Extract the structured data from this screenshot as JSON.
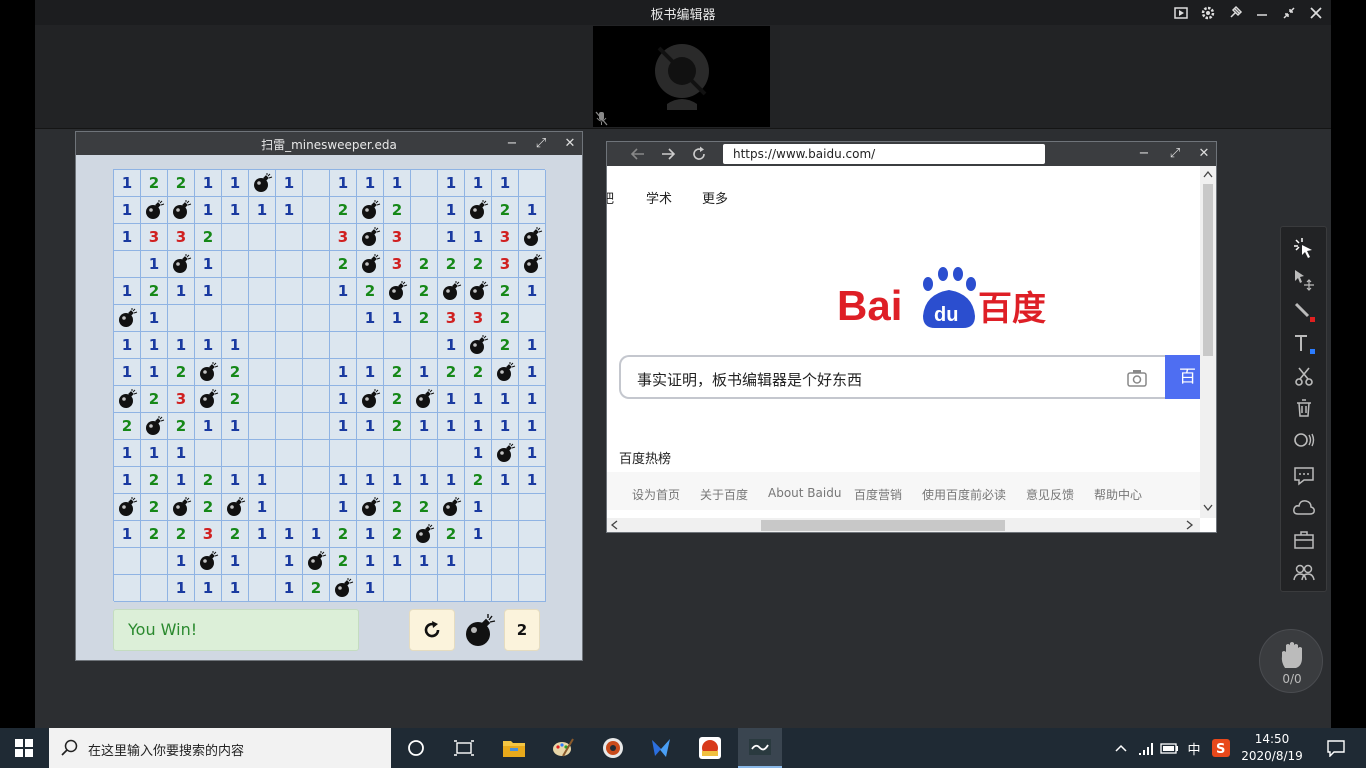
{
  "app": {
    "title": "板书编辑器"
  },
  "minesweeper": {
    "title": "扫雷_minesweeper.eda",
    "grid": [
      [
        "1",
        "2",
        "2",
        "1",
        "1",
        "*",
        "1",
        "",
        "1",
        "1",
        "1",
        "",
        "1",
        "1",
        "1",
        ""
      ],
      [
        "1",
        "*",
        "*",
        "1",
        "1",
        "1",
        "1",
        "",
        "2",
        "*",
        "2",
        "",
        "1",
        "*",
        "2",
        "1"
      ],
      [
        "1",
        "3",
        "3",
        "2",
        "",
        "",
        "",
        "",
        "3",
        "*",
        "3",
        "",
        "1",
        "1",
        "3",
        "*"
      ],
      [
        "",
        "1",
        "*",
        "1",
        "",
        "",
        "",
        "",
        "2",
        "*",
        "3",
        "2",
        "2",
        "2",
        "3",
        "*"
      ],
      [
        "1",
        "2",
        "1",
        "1",
        "",
        "",
        "",
        "",
        "1",
        "2",
        "*",
        "2",
        "*",
        "*",
        "2",
        "1"
      ],
      [
        "*",
        "1",
        "",
        "",
        "",
        "",
        "",
        "",
        "",
        "1",
        "1",
        "2",
        "3",
        "3",
        "2",
        ""
      ],
      [
        "1",
        "1",
        "1",
        "1",
        "1",
        "",
        "",
        "",
        "",
        "",
        "",
        "",
        "1",
        "*",
        "2",
        "1"
      ],
      [
        "1",
        "1",
        "2",
        "*",
        "2",
        "",
        "",
        "",
        "1",
        "1",
        "2",
        "1",
        "2",
        "2",
        "*",
        "1"
      ],
      [
        "*",
        "2",
        "3",
        "*",
        "2",
        "",
        "",
        "",
        "1",
        "*",
        "2",
        "*",
        "1",
        "1",
        "1",
        "1"
      ],
      [
        "2",
        "*",
        "2",
        "1",
        "1",
        "",
        "",
        "",
        "1",
        "1",
        "2",
        "1",
        "1",
        "1",
        "1",
        "1"
      ],
      [
        "1",
        "1",
        "1",
        "",
        "",
        "",
        "",
        "",
        "",
        "",
        "",
        "",
        "",
        "1",
        "*",
        "1"
      ],
      [
        "1",
        "2",
        "1",
        "2",
        "1",
        "1",
        "",
        "",
        "1",
        "1",
        "1",
        "1",
        "1",
        "2",
        "1",
        "1"
      ],
      [
        "*",
        "2",
        "*",
        "2",
        "*",
        "1",
        "",
        "",
        "1",
        "*",
        "2",
        "2",
        "*",
        "1",
        "",
        ""
      ],
      [
        "1",
        "2",
        "2",
        "3",
        "2",
        "1",
        "1",
        "1",
        "2",
        "1",
        "2",
        "*",
        "2",
        "1",
        "",
        ""
      ],
      [
        "",
        "",
        "1",
        "*",
        "1",
        "",
        "1",
        "*",
        "2",
        "1",
        "1",
        "1",
        "1",
        "",
        "",
        ""
      ],
      [
        "",
        "",
        "1",
        "1",
        "1",
        "",
        "1",
        "2",
        "*",
        "1",
        "",
        "",
        "",
        "",
        "",
        ""
      ]
    ],
    "status": "You Win!",
    "mine_count": "2"
  },
  "browser": {
    "url": "https://www.baidu.com/",
    "nav": [
      "吧",
      "学术",
      "更多"
    ],
    "search_value": "事实证明，板书编辑器是个好东西",
    "search_button": "百",
    "hot": "百度热榜",
    "footer": [
      "设为首页",
      "关于百度",
      "About Baidu",
      "百度营销",
      "使用百度前必读",
      "意见反馈",
      "帮助中心"
    ]
  },
  "hand_count": "0/0",
  "taskbar": {
    "search_placeholder": "在这里输入你要搜索的内容",
    "ime": "中",
    "time": "14:50",
    "date": "2020/8/19"
  }
}
